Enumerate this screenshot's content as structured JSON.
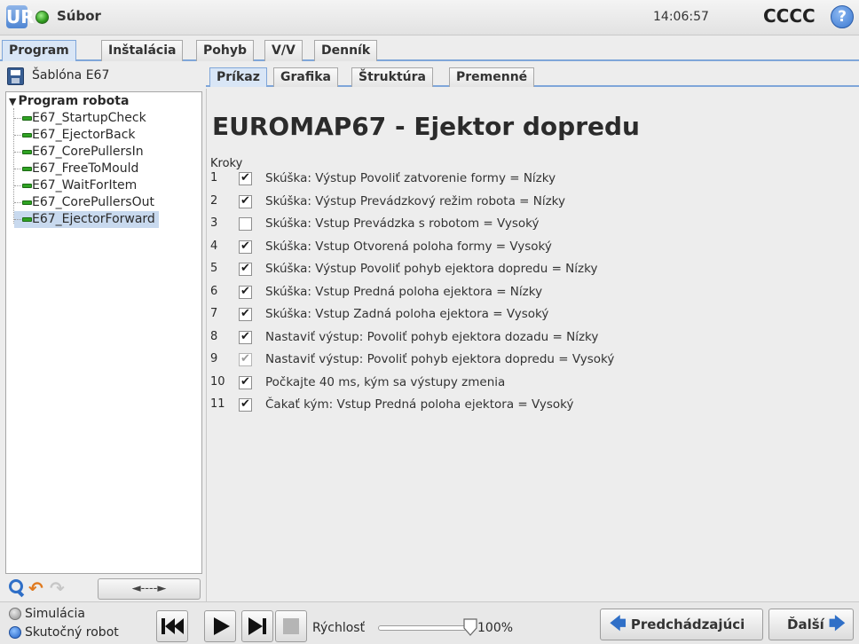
{
  "topbar": {
    "logo": "UR",
    "file_menu": "Súbor",
    "clock": "14:06:57",
    "robot_name": "CCCC",
    "help": "?"
  },
  "main_tabs": [
    "Program",
    "Inštalácia",
    "Pohyb",
    "V/V",
    "Denník"
  ],
  "template_label": "Šablóna E67",
  "tree": {
    "root": "Program robota",
    "items": [
      "E67_StartupCheck",
      "E67_EjectorBack",
      "E67_CorePullersIn",
      "E67_FreeToMould",
      "E67_WaitForItem",
      "E67_CorePullersOut",
      "E67_EjectorForward"
    ],
    "selected_index": 6
  },
  "sub_tabs": [
    "Príkaz",
    "Grafika",
    "Štruktúra",
    "Premenné"
  ],
  "command": {
    "title": "EUROMAP67 - Ejektor dopredu",
    "steps_label": "Kroky",
    "steps": [
      {
        "num": "1",
        "state": "checked",
        "text": "Skúška: Výstup Povoliť zatvorenie formy = Nízky"
      },
      {
        "num": "2",
        "state": "checked",
        "text": "Skúška: Výstup Prevádzkový režim robota = Nízky"
      },
      {
        "num": "3",
        "state": "unchecked",
        "text": "Skúška: Vstup Prevádzka s robotom = Vysoký"
      },
      {
        "num": "4",
        "state": "checked",
        "text": "Skúška: Vstup Otvorená poloha formy = Vysoký"
      },
      {
        "num": "5",
        "state": "checked",
        "text": "Skúška: Výstup Povoliť pohyb ejektora dopredu = Nízky"
      },
      {
        "num": "6",
        "state": "checked",
        "text": "Skúška: Vstup Predná poloha ejektora = Nízky"
      },
      {
        "num": "7",
        "state": "checked",
        "text": "Skúška: Vstup Zadná poloha ejektora = Vysoký"
      },
      {
        "num": "8",
        "state": "checked",
        "text": "Nastaviť výstup: Povoliť pohyb ejektora dozadu = Nízky"
      },
      {
        "num": "9",
        "state": "checked-disabled",
        "text": "Nastaviť výstup: Povoliť pohyb ejektora dopredu = Vysoký"
      },
      {
        "num": "10",
        "state": "checked",
        "text": "Počkajte 40 ms, kým sa výstupy zmenia"
      },
      {
        "num": "11",
        "state": "checked",
        "text": "Čakať kým: Vstup Predná poloha ejektora = Vysoký"
      }
    ]
  },
  "left_tools": {
    "move_label": "◄----►"
  },
  "bottombar": {
    "mode_sim": "Simulácia",
    "mode_real": "Skutočný robot",
    "selected_mode": "real",
    "speed_label": "Rýchlosť",
    "speed_value": "100%",
    "speed_fraction": 1.0,
    "prev_label": "Predchádzajúci",
    "next_label": "Ďalší"
  },
  "colors": {
    "accent": "#7fa6d9",
    "selected_row": "#c8d9ee",
    "command_icon": "#2fa323"
  }
}
